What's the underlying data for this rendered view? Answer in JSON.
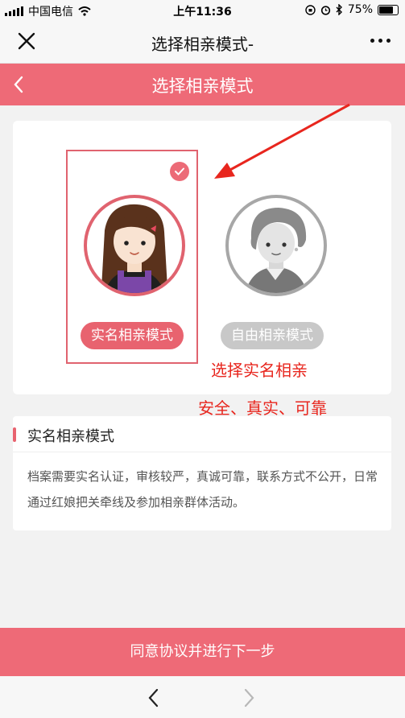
{
  "status": {
    "carrier": "中国电信",
    "time": "上午11:36",
    "battery": "75%",
    "battery_level": 0.75
  },
  "wechat_nav": {
    "title": "选择相亲模式-"
  },
  "header": {
    "title": "选择相亲模式"
  },
  "modes": [
    {
      "label": "实名相亲模式",
      "selected": true
    },
    {
      "label": "自由相亲模式",
      "selected": false
    }
  ],
  "annotations": {
    "line1": "选择实名相亲",
    "line2": "安全、真实、可靠"
  },
  "description": {
    "title": "实名相亲模式",
    "text": "档案需要实名认证，审核较严，真诚可靠，联系方式不公开，日常通过红娘把关牵线及参加相亲群体活动。"
  },
  "footer": {
    "agree_button": "同意协议并进行下一步"
  },
  "colors": {
    "accent": "#ee6a77",
    "annotation": "#e8261e"
  }
}
